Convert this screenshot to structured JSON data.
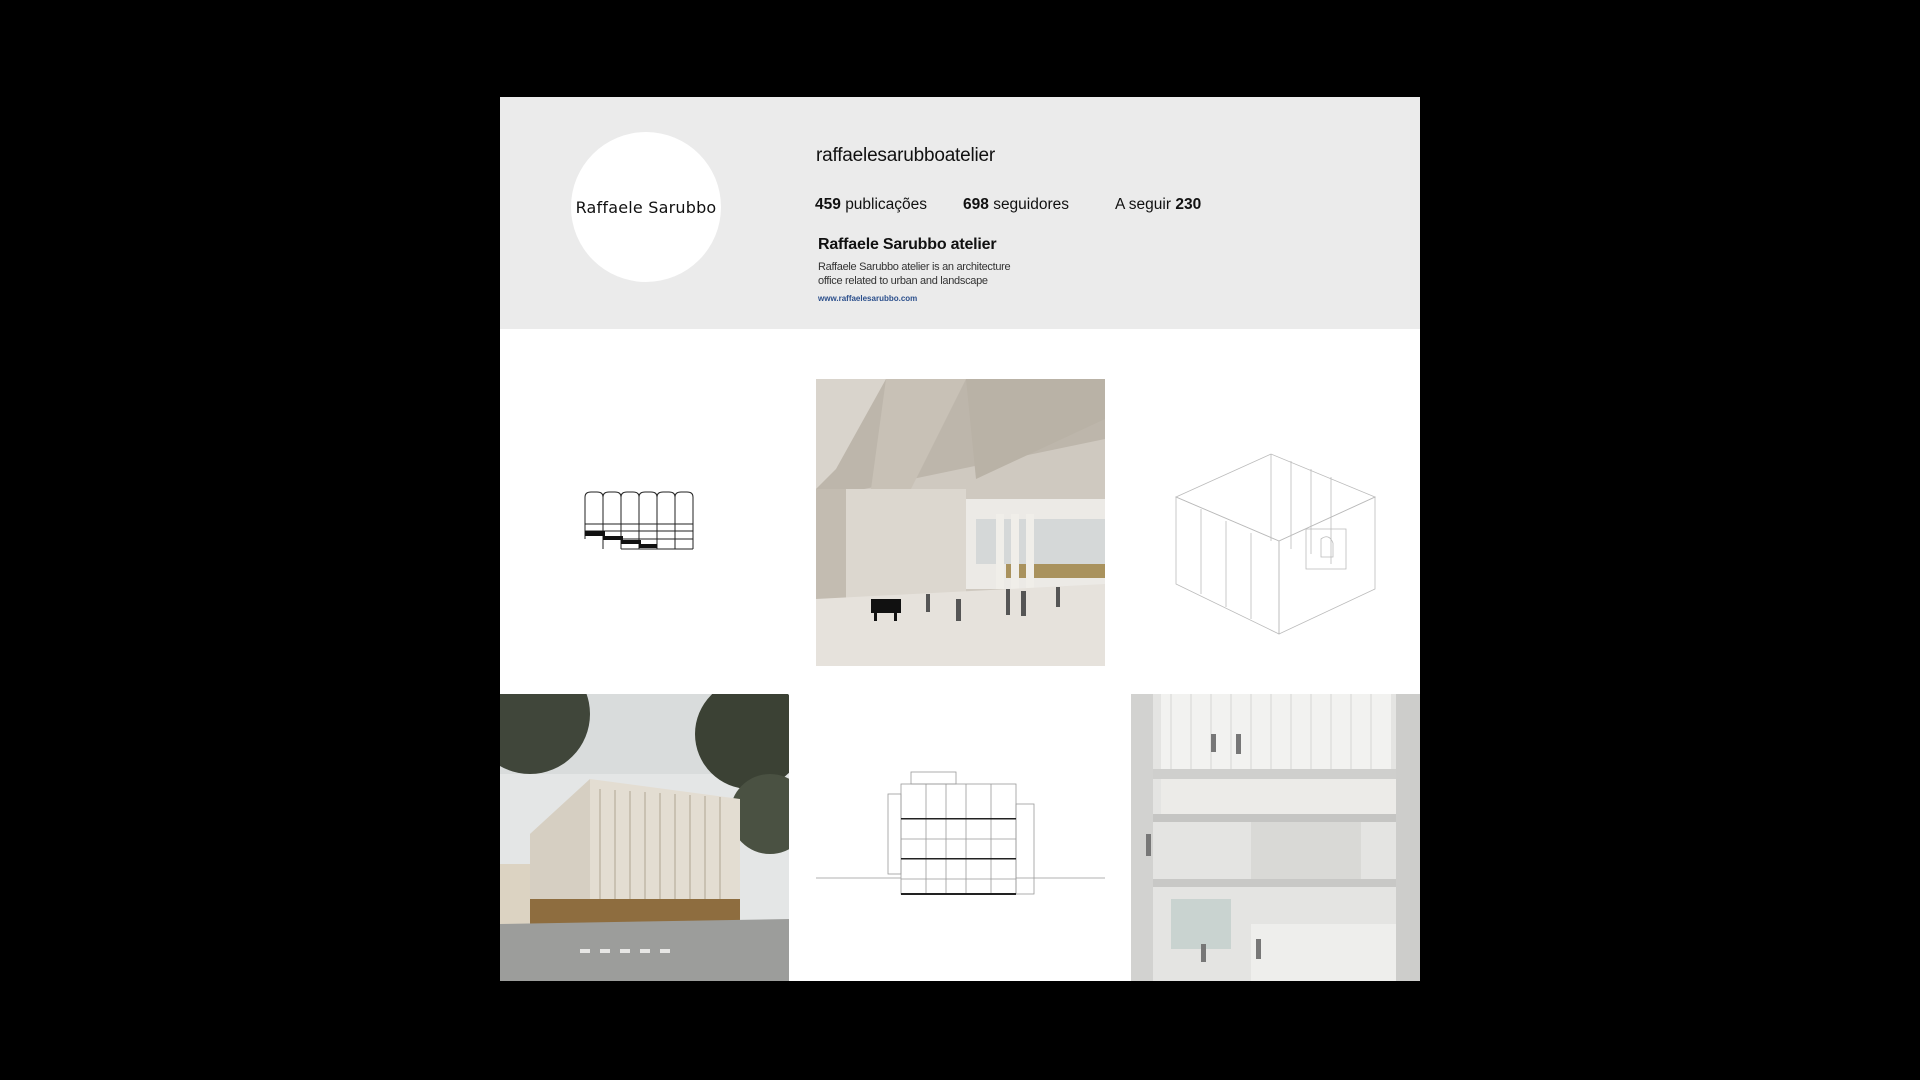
{
  "profile": {
    "avatar_text": "Raffaele Sarubbo",
    "username": "raffaelesarubboatelier",
    "stats": {
      "posts_count": "459",
      "posts_label": "publicações",
      "followers_count": "698",
      "followers_label": "seguidores",
      "following_label": "A seguir",
      "following_count": "230"
    },
    "display_name": "Raffaele Sarubbo atelier",
    "bio_line1": "Raffaele Sarubbo atelier is an architecture",
    "bio_line2": "office related to urban and landscape",
    "website": "www.raffaelesarubbo.com"
  },
  "colors": {
    "page_background": "#000000",
    "header_background": "#ebebeb",
    "link": "#2b4f8c"
  },
  "grid": {
    "posts": [
      {
        "name": "post-arch-elevation-drawing",
        "kind": "line drawing"
      },
      {
        "name": "post-concert-hall-interior-render",
        "kind": "render"
      },
      {
        "name": "post-bathroom-axonometric-drawing",
        "kind": "line drawing"
      },
      {
        "name": "post-building-exterior-render",
        "kind": "render"
      },
      {
        "name": "post-building-section-drawing",
        "kind": "line drawing"
      },
      {
        "name": "post-atrium-interior-render",
        "kind": "render"
      }
    ]
  }
}
